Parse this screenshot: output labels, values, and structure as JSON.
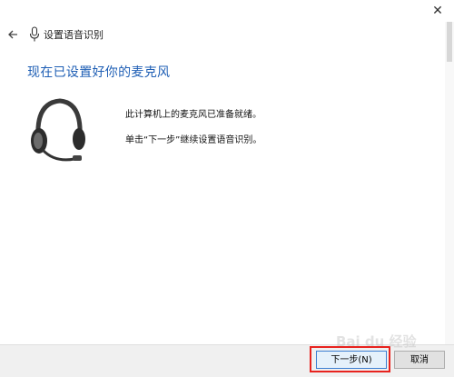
{
  "window": {
    "close_glyph": "✕"
  },
  "nav": {
    "title": "设置语音识别",
    "back_icon": "back-arrow-icon",
    "mic_icon": "microphone-icon"
  },
  "content": {
    "heading": "现在已设置好你的麦克风",
    "message_ready": "此计算机上的麦克风已准备就绪。",
    "message_next": "单击“下一步”继续设置语音识别。",
    "image": "headset-icon"
  },
  "footer": {
    "next_label": "下一步(N)",
    "cancel_label": "取消"
  },
  "colors": {
    "heading": "#1f5fb5",
    "highlight": "#e8231e",
    "footer_bg": "#f0f0f0"
  },
  "watermark": {
    "text": "Bai du 经验"
  }
}
